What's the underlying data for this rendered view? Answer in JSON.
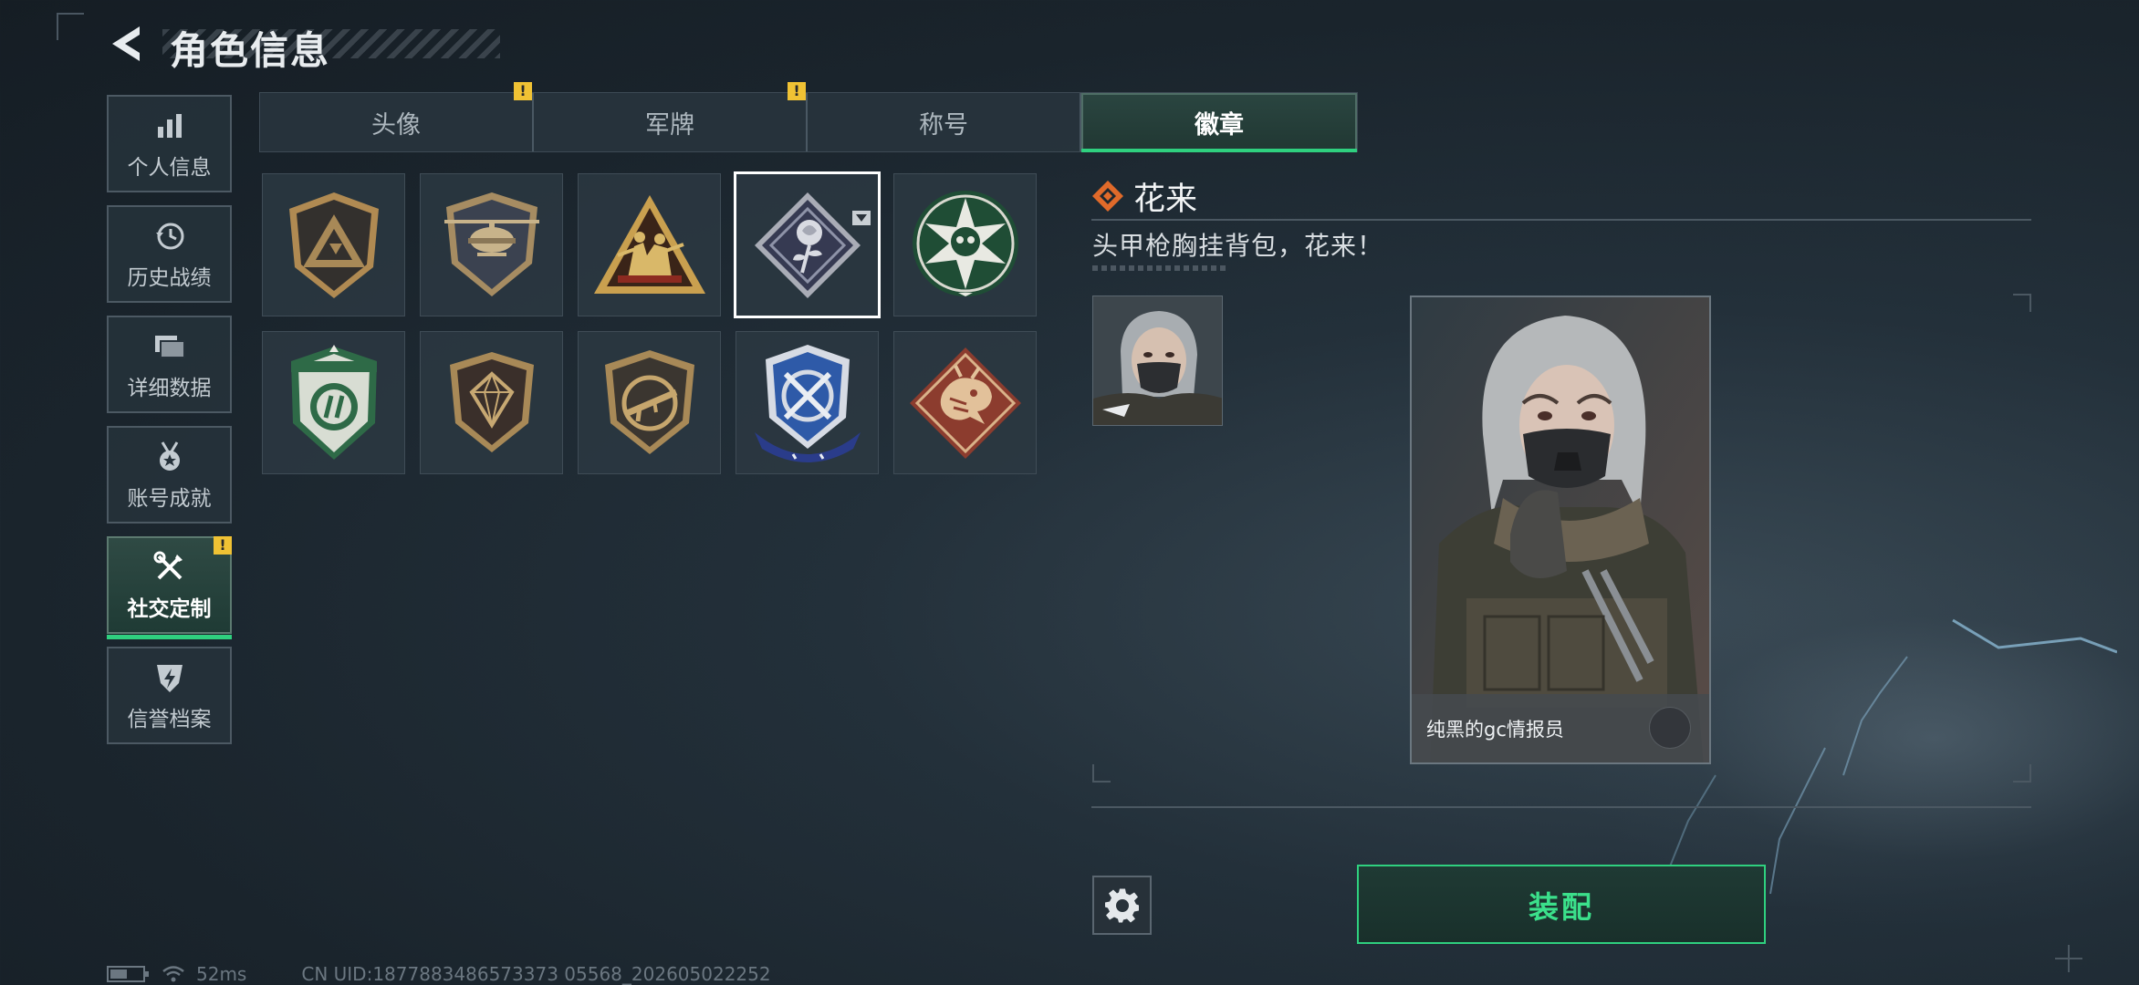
{
  "header": {
    "title": "角色信息",
    "back_icon": "chevron-left-icon"
  },
  "side_nav": {
    "items": [
      {
        "label": "个人信息",
        "icon": "bar-chart-icon",
        "active": false
      },
      {
        "label": "历史战绩",
        "icon": "history-clock-icon",
        "active": false
      },
      {
        "label": "详细数据",
        "icon": "folder-stack-icon",
        "active": false
      },
      {
        "label": "账号成就",
        "icon": "medal-icon",
        "active": false
      },
      {
        "label": "社交定制",
        "icon": "wrench-screwdriver-icon",
        "active": true,
        "badge": "!"
      },
      {
        "label": "信誉档案",
        "icon": "shield-bolt-icon",
        "active": false
      }
    ]
  },
  "tabs": [
    {
      "label": "头像",
      "badge": "!"
    },
    {
      "label": "军牌",
      "badge": "!"
    },
    {
      "label": "称号"
    },
    {
      "label": "徽章",
      "active": true
    }
  ],
  "badges": {
    "items": [
      {
        "name": "triangle-shield-badge",
        "selected": false
      },
      {
        "name": "helicopter-badge",
        "selected": false
      },
      {
        "name": "soldiers-triangle-badge",
        "selected": false
      },
      {
        "name": "rose-diamond-badge",
        "selected": true
      },
      {
        "name": "green-star-skull-badge",
        "selected": false
      },
      {
        "name": "green-emblem-badge",
        "selected": false
      },
      {
        "name": "crystal-shield-badge",
        "selected": false
      },
      {
        "name": "rifle-circle-badge",
        "selected": false
      },
      {
        "name": "crossed-knives-crest-badge",
        "selected": false
      },
      {
        "name": "dragon-diamond-badge",
        "selected": false
      }
    ]
  },
  "detail": {
    "name": "花来",
    "description": "头甲枪胸挂背包，花来！",
    "character_name": "纯黑的gc情报员"
  },
  "actions": {
    "equip_label": "装配",
    "settings_icon": "gear-icon"
  },
  "status_bar": {
    "ping": "52ms",
    "uid": "CN UID:1877883486573373 05568_202605022252"
  },
  "colors": {
    "accent_green": "#2fd07f",
    "warning_yellow": "#f0c234"
  }
}
